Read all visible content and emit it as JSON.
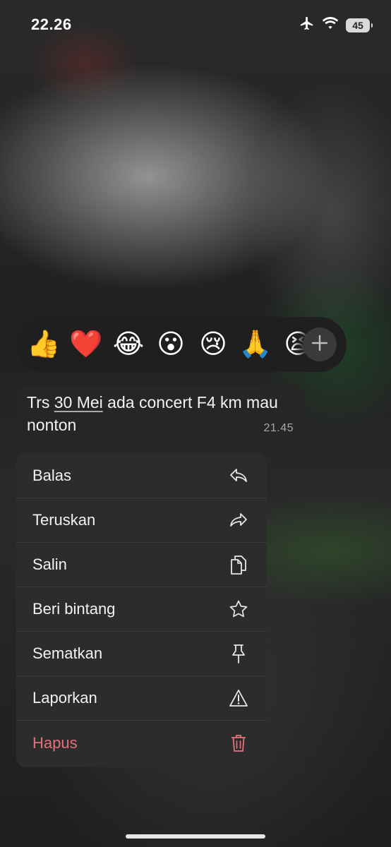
{
  "status_bar": {
    "time": "22.26",
    "battery": "45"
  },
  "reactions": [
    "👍",
    "❤️",
    "😂",
    "😮",
    "😢",
    "🙏",
    "😫"
  ],
  "message": {
    "text_before": "Trs ",
    "text_link": "30 Mei",
    "text_after": " ada concert F4 km mau nonton",
    "time": "21.45"
  },
  "menu": {
    "items": [
      {
        "label": "Balas",
        "icon": "reply-icon"
      },
      {
        "label": "Teruskan",
        "icon": "forward-icon"
      },
      {
        "label": "Salin",
        "icon": "copy-icon"
      },
      {
        "label": "Beri bintang",
        "icon": "star-icon"
      },
      {
        "label": "Sematkan",
        "icon": "pin-icon"
      },
      {
        "label": "Laporkan",
        "icon": "warning-icon"
      },
      {
        "label": "Hapus",
        "icon": "trash-icon"
      }
    ],
    "danger_color": "#e5707d"
  }
}
